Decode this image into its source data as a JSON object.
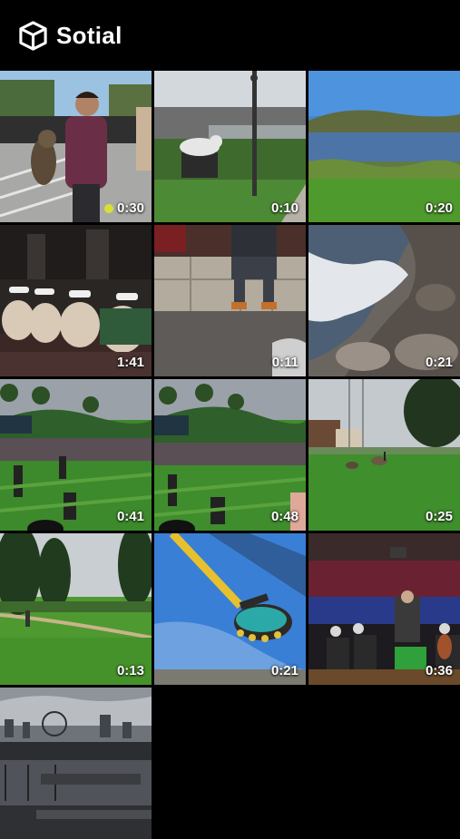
{
  "app": {
    "title": "Sotial",
    "logo_icon": "cube-icon"
  },
  "videos": [
    {
      "duration": "0:30",
      "scene": "person holding owl on bleachers"
    },
    {
      "duration": "0:10",
      "scene": "tiger statue on lawn"
    },
    {
      "duration": "0:20",
      "scene": "lake with grassy hills"
    },
    {
      "duration": "1:41",
      "scene": "audience wearing VR headsets"
    },
    {
      "duration": "0:11",
      "scene": "person sitting on stone ledge"
    },
    {
      "duration": "0:21",
      "scene": "waves on rocky shore"
    },
    {
      "duration": "0:41",
      "scene": "golf tournament crowd"
    },
    {
      "duration": "0:48",
      "scene": "golf tournament crowd with camera"
    },
    {
      "duration": "0:25",
      "scene": "geese on green lawn"
    },
    {
      "duration": "0:13",
      "scene": "golf course fairway with trees"
    },
    {
      "duration": "0:21",
      "scene": "amusement park swing ride"
    },
    {
      "duration": "0:36",
      "scene": "orchestra concert"
    },
    {
      "duration": "",
      "scene": "city waterfront with ferris wheel"
    }
  ]
}
